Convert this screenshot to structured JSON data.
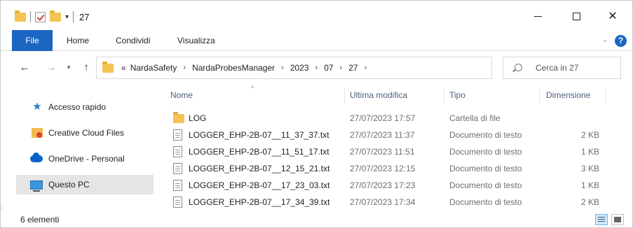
{
  "window": {
    "title": "27",
    "controls": {
      "minimize_icon": "minimize-icon",
      "maximize_icon": "maximize-icon",
      "close_icon": "close-icon",
      "close_glyph": "✕"
    }
  },
  "quick_access_toolbar": {
    "dropdown_glyph": "▾"
  },
  "ribbon": {
    "tabs": [
      {
        "label": "File"
      },
      {
        "label": "Home"
      },
      {
        "label": "Condividi"
      },
      {
        "label": "Visualizza"
      }
    ],
    "expand_glyph": "⌄",
    "help_glyph": "?",
    "accent": "#1a66c2"
  },
  "navigation": {
    "back_glyph": "←",
    "forward_glyph": "→",
    "recent_glyph": "▾",
    "up_glyph": "↑",
    "breadcrumb_prefix": "«",
    "breadcrumbs": [
      "NardaSafety",
      "NardaProbesManager",
      "2023",
      "07",
      "27"
    ],
    "breadcrumb_sep": "›",
    "dropdown_glyph": "⌄",
    "refresh_glyph": "↻",
    "search_placeholder": "Cerca in 27"
  },
  "sidebar": {
    "items": [
      {
        "label": "Accesso rapido",
        "icon": "star-icon",
        "selected": false
      },
      {
        "label": "Creative Cloud Files",
        "icon": "creative-cloud-folder-icon",
        "selected": false
      },
      {
        "label": "OneDrive - Personal",
        "icon": "onedrive-cloud-icon",
        "selected": false
      },
      {
        "label": "Questo PC",
        "icon": "computer-icon",
        "selected": true
      }
    ]
  },
  "file_list": {
    "columns": {
      "name": "Nome",
      "date": "Ultima modifica",
      "type": "Tipo",
      "size": "Dimensione"
    },
    "sort_glyph": "^",
    "rows": [
      {
        "name": "LOG",
        "date": "27/07/2023 17:57",
        "type": "Cartella di file",
        "size": "",
        "icon": "folder-icon"
      },
      {
        "name": "LOGGER_EHP-2B-07__11_37_37.txt",
        "date": "27/07/2023 11:37",
        "type": "Documento di testo",
        "size": "2 KB",
        "icon": "text-file-icon"
      },
      {
        "name": "LOGGER_EHP-2B-07__11_51_17.txt",
        "date": "27/07/2023 11:51",
        "type": "Documento di testo",
        "size": "1 KB",
        "icon": "text-file-icon"
      },
      {
        "name": "LOGGER_EHP-2B-07__12_15_21.txt",
        "date": "27/07/2023 12:15",
        "type": "Documento di testo",
        "size": "3 KB",
        "icon": "text-file-icon"
      },
      {
        "name": "LOGGER_EHP-2B-07__17_23_03.txt",
        "date": "27/07/2023 17:23",
        "type": "Documento di testo",
        "size": "1 KB",
        "icon": "text-file-icon"
      },
      {
        "name": "LOGGER_EHP-2B-07__17_34_39.txt",
        "date": "27/07/2023 17:34",
        "type": "Documento di testo",
        "size": "2 KB",
        "icon": "text-file-icon"
      }
    ]
  },
  "status_bar": {
    "count_text": "6 elementi",
    "view_buttons": [
      "details-view-icon",
      "large-icons-view-icon"
    ]
  }
}
